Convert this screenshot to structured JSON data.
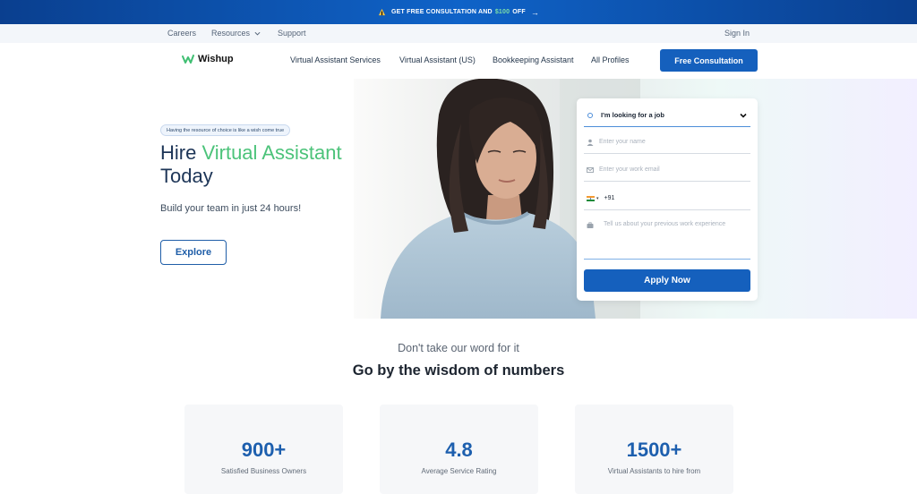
{
  "promo": {
    "text_before": "GET FREE CONSULTATION AND",
    "highlight": "$100",
    "text_after": "OFF",
    "arrow": "→"
  },
  "subnav": {
    "careers": "Careers",
    "resources": "Resources",
    "support": "Support",
    "sign_in": "Sign In"
  },
  "nav": {
    "brand": "Wishup",
    "links": [
      "Virtual Assistant Services",
      "Virtual Assistant (US)",
      "Bookkeeping Assistant",
      "All Profiles"
    ],
    "cta": "Free Consultation"
  },
  "hero": {
    "tag": "Having the resource of choice is like a wish come true",
    "title_plain": "Hire",
    "title_accent": "Virtual Assistant",
    "title_line2": "Today",
    "subtitle": "Build your team in just 24 hours!",
    "explore": "Explore"
  },
  "form": {
    "role_selected": "I'm looking for a job",
    "name_placeholder": "Enter your name",
    "email_placeholder": "Enter your work email",
    "phone_code": "+91",
    "experience_placeholder": "Tell us about your previous work experience",
    "apply": "Apply Now"
  },
  "stats": {
    "eyebrow": "Don't take our word for it",
    "heading": "Go by the wisdom of numbers",
    "items": [
      {
        "value": "900+",
        "label": "Satisfied Business Owners"
      },
      {
        "value": "4.8",
        "label": "Average Service Rating"
      },
      {
        "value": "1500+",
        "label": "Virtual Assistants to hire from"
      }
    ]
  },
  "colors": {
    "primary": "#1560bd",
    "accent_green": "#4cc37a",
    "heading_navy": "#1d3557"
  }
}
